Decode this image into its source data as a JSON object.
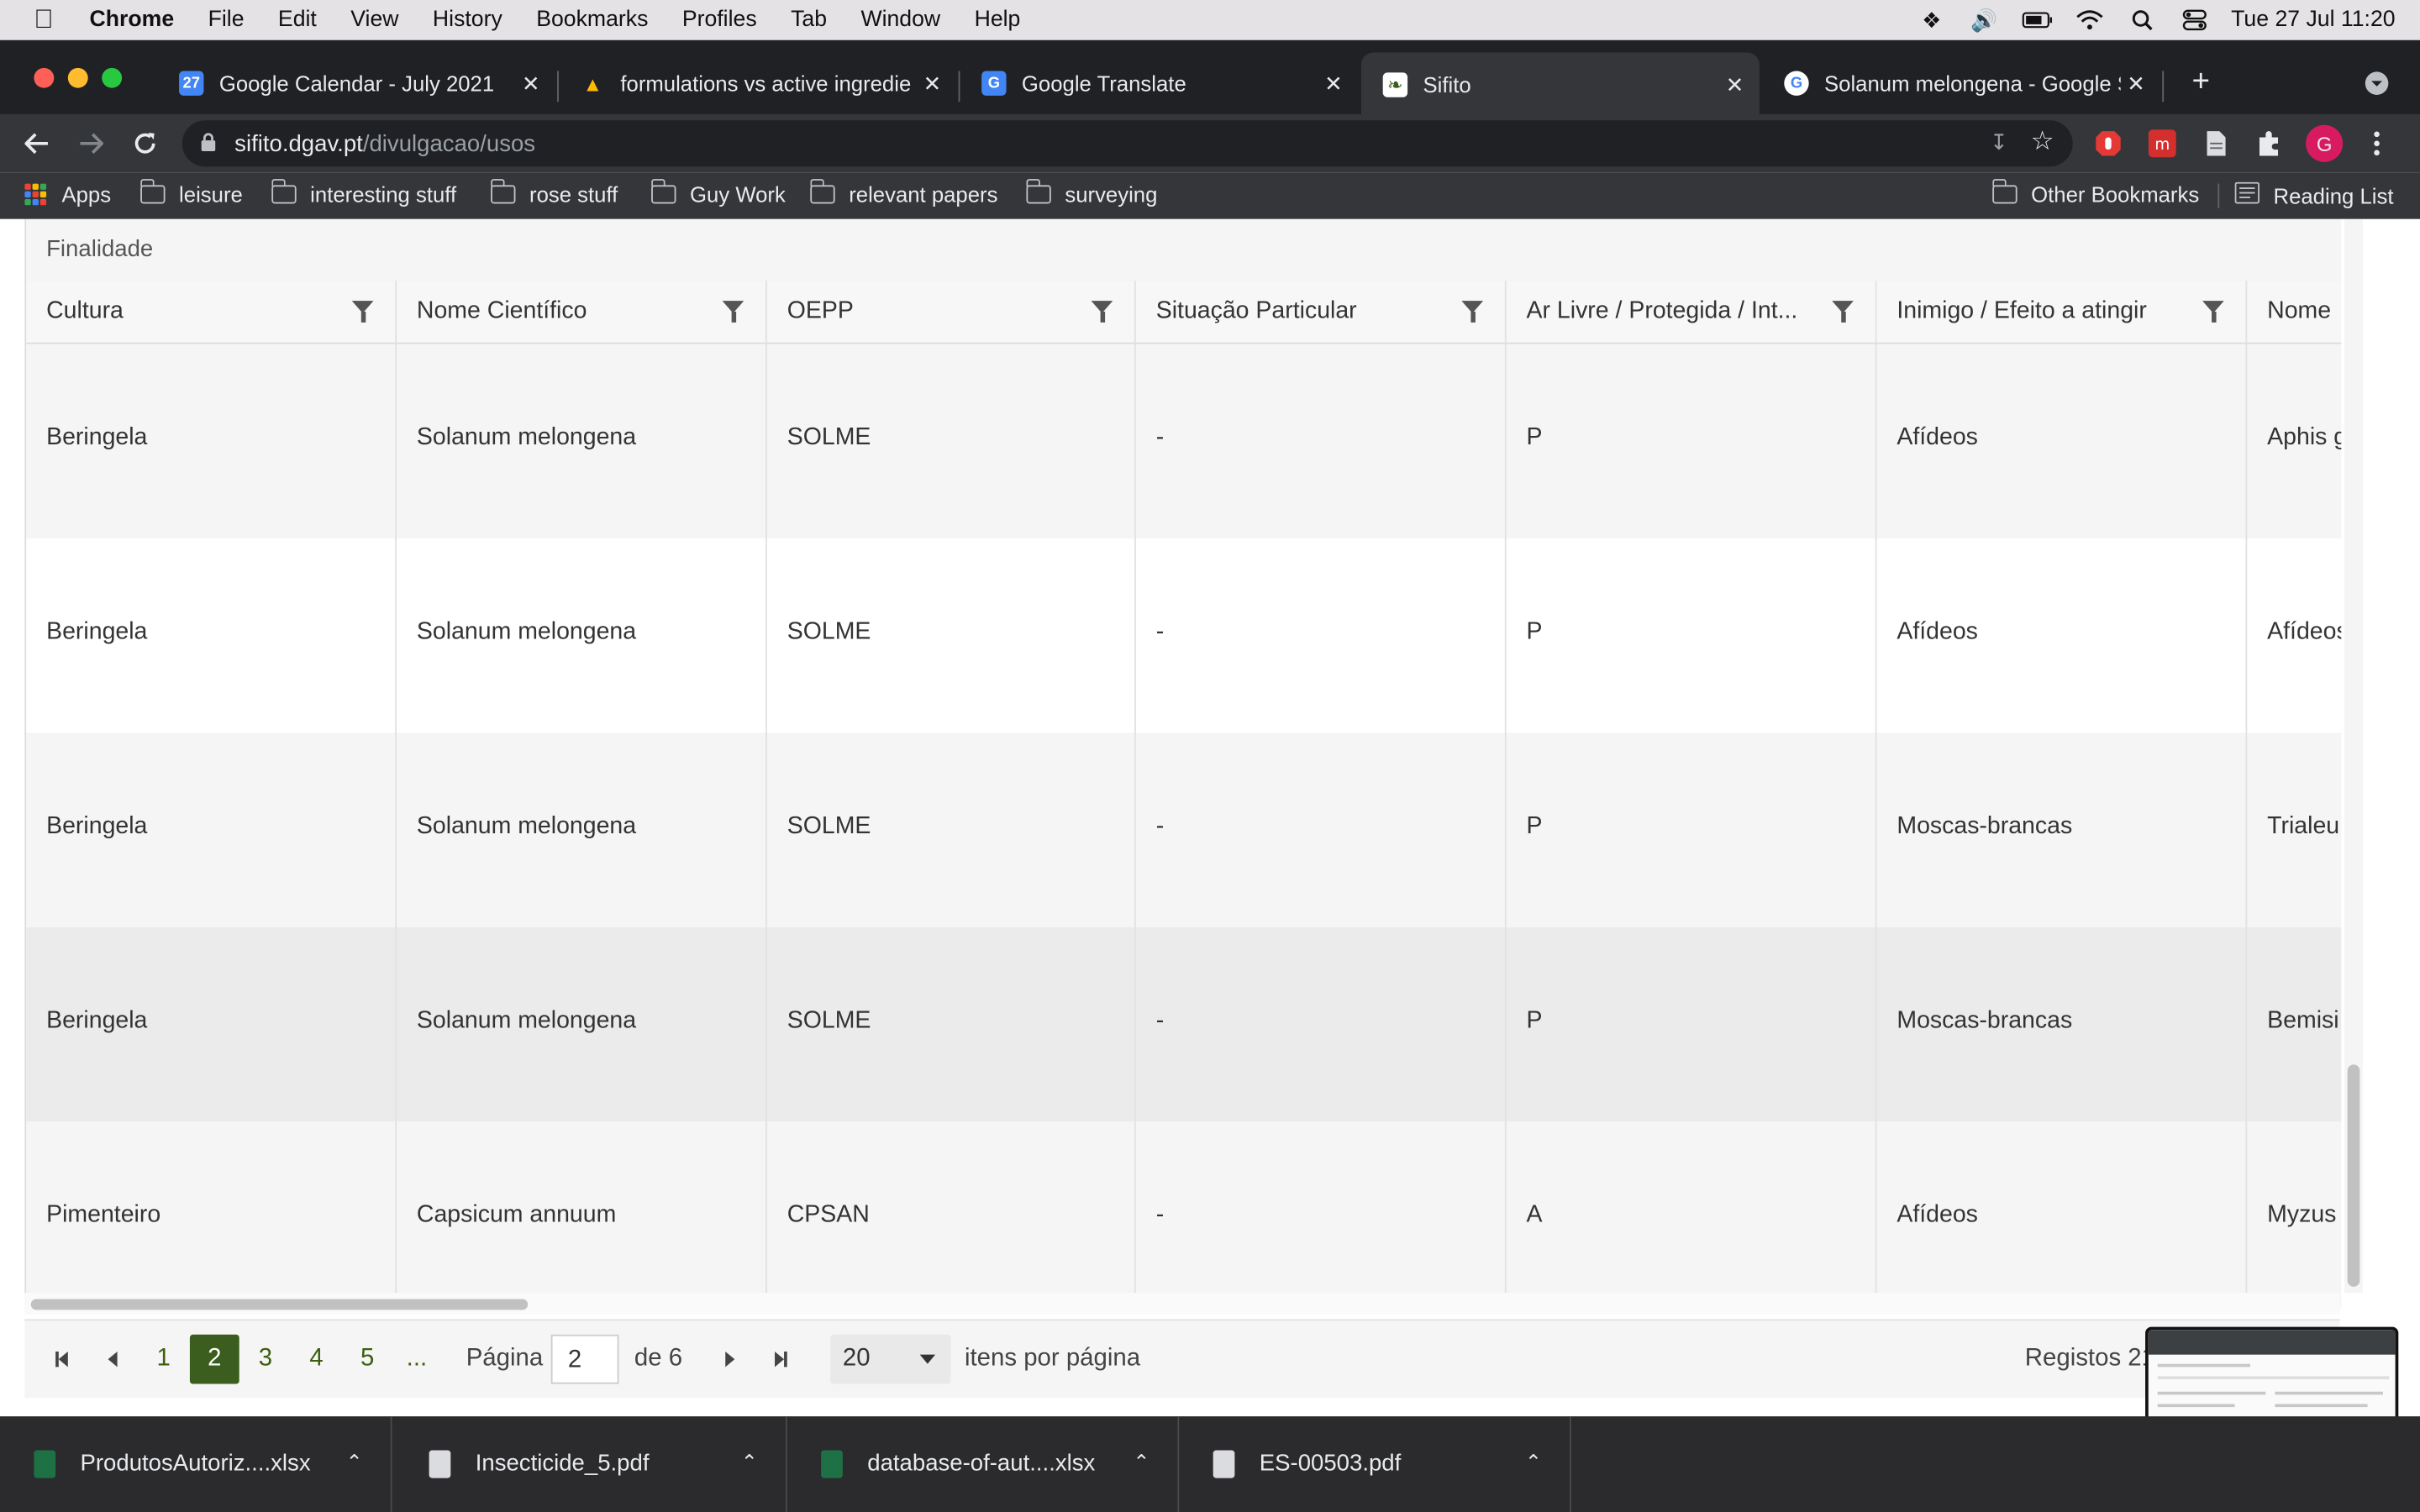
{
  "menubar": {
    "app": "Chrome",
    "items": [
      "File",
      "Edit",
      "View",
      "History",
      "Bookmarks",
      "Profiles",
      "Tab",
      "Window",
      "Help"
    ],
    "datetime": "Tue 27 Jul  11:20"
  },
  "tabs": [
    {
      "title": "Google Calendar - July 2021",
      "favicon_text": "27",
      "color": "#4285f4"
    },
    {
      "title": "formulations vs active ingredie",
      "favicon_text": "▲",
      "color": "#fbbc04"
    },
    {
      "title": "Google Translate",
      "favicon_text": "G",
      "color": "#4285f4"
    },
    {
      "title": "Sifito",
      "favicon_text": "❧",
      "color": "#ffffff"
    },
    {
      "title": "Solanum melongena - Google S",
      "favicon_text": "G",
      "color": "#ffffff"
    }
  ],
  "omnibox": {
    "host": "sifito.dgav.pt",
    "path": "/divulgacao/usos"
  },
  "profile_initial": "G",
  "bookmarks": {
    "apps": "Apps",
    "folders": [
      "leisure",
      "interesting stuff",
      "rose stuff",
      "Guy Work",
      "relevant papers",
      "surveying"
    ],
    "other": "Other Bookmarks",
    "reading_list": "Reading List"
  },
  "grid": {
    "group_label": "Finalidade",
    "columns": [
      "Cultura",
      "Nome Científico",
      "OEPP",
      "Situação Particular",
      "Ar Livre / Protegida / Int...",
      "Inimigo / Efeito a atingir",
      "Nome"
    ],
    "rows": [
      [
        "Beringela",
        "Solanum melongena",
        "SOLME",
        "-",
        "P",
        "Afídeos",
        "Aphis g"
      ],
      [
        "Beringela",
        "Solanum melongena",
        "SOLME",
        "-",
        "P",
        "Afídeos",
        "Afídeos"
      ],
      [
        "Beringela",
        "Solanum melongena",
        "SOLME",
        "-",
        "P",
        "Moscas-brancas",
        "Trialeu"
      ],
      [
        "Beringela",
        "Solanum melongena",
        "SOLME",
        "-",
        "P",
        "Moscas-brancas",
        "Bemisi"
      ],
      [
        "Pimenteiro",
        "Capsicum annuum",
        "CPSAN",
        "-",
        "A",
        "Afídeos",
        "Myzus"
      ]
    ]
  },
  "pager": {
    "pages": [
      "1",
      "2",
      "3",
      "4",
      "5",
      "..."
    ],
    "current_page": "2",
    "page_label": "Página",
    "page_value": "2",
    "of_label": "de 6",
    "page_size": "20",
    "per_page_label": "itens por página",
    "records_label": "Registos 21"
  },
  "downloads": [
    {
      "name": "ProdutosAutoriz....xlsx",
      "type": "xlsx"
    },
    {
      "name": "Insecticide_5.pdf",
      "type": "pdf"
    },
    {
      "name": "database-of-aut....xlsx",
      "type": "xlsx"
    },
    {
      "name": "ES-00503.pdf",
      "type": "pdf"
    }
  ],
  "colors": {
    "accent_page": "#3b5d1d",
    "chrome_dark": "#35363a",
    "tab_bar": "#202124"
  }
}
